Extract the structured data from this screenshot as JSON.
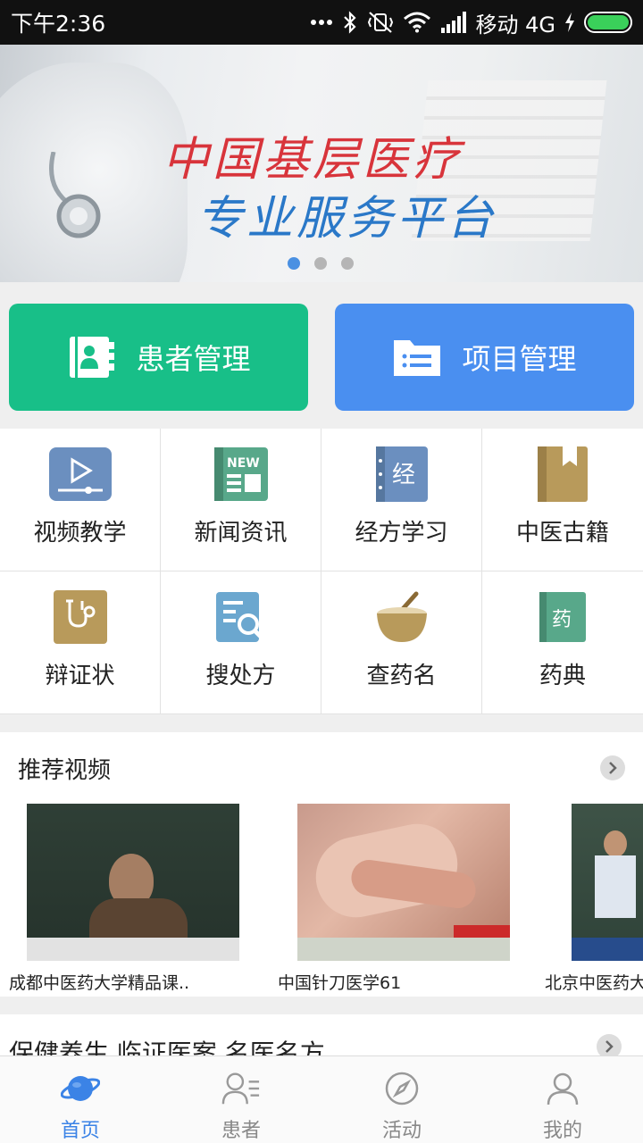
{
  "status_bar": {
    "time": "下午2:36",
    "carrier": "移动 4G",
    "icons": [
      "more-dots-icon",
      "bluetooth-icon",
      "vibrate-off-icon",
      "wifi-icon",
      "signal-icon",
      "charging-icon",
      "battery-icon"
    ]
  },
  "banner": {
    "line1": "中国基层医疗",
    "line2": "专业服务平台",
    "slide_count": 3,
    "active_slide": 1
  },
  "quick_actions": {
    "patient_label": "患者管理",
    "project_label": "项目管理",
    "patient_color": "#18bf88",
    "project_color": "#4a8ff0"
  },
  "grid": [
    {
      "label": "视频教学",
      "icon": "video-icon"
    },
    {
      "label": "新闻资讯",
      "icon": "news-icon"
    },
    {
      "label": "经方学习",
      "icon": "classic-formula-book-icon"
    },
    {
      "label": "中医古籍",
      "icon": "bookmark-book-icon"
    },
    {
      "label": "辩证状",
      "icon": "stethoscope-icon"
    },
    {
      "label": "搜处方",
      "icon": "search-prescription-icon"
    },
    {
      "label": "查药名",
      "icon": "mortar-icon"
    },
    {
      "label": "药典",
      "icon": "pharmacopoeia-book-icon"
    }
  ],
  "recommend": {
    "title": "推荐视频",
    "videos": [
      {
        "caption": "成都中医药大学精品课.."
      },
      {
        "caption": "中国针刀医学61"
      },
      {
        "caption": "北京中医药大"
      }
    ]
  },
  "section2": {
    "title": "保健养生 临证医案 名医名方"
  },
  "tabs": [
    {
      "label": "首页",
      "icon": "planet-home-icon",
      "active": true
    },
    {
      "label": "患者",
      "icon": "patients-icon",
      "active": false
    },
    {
      "label": "活动",
      "icon": "compass-icon",
      "active": false
    },
    {
      "label": "我的",
      "icon": "profile-icon",
      "active": false
    }
  ]
}
